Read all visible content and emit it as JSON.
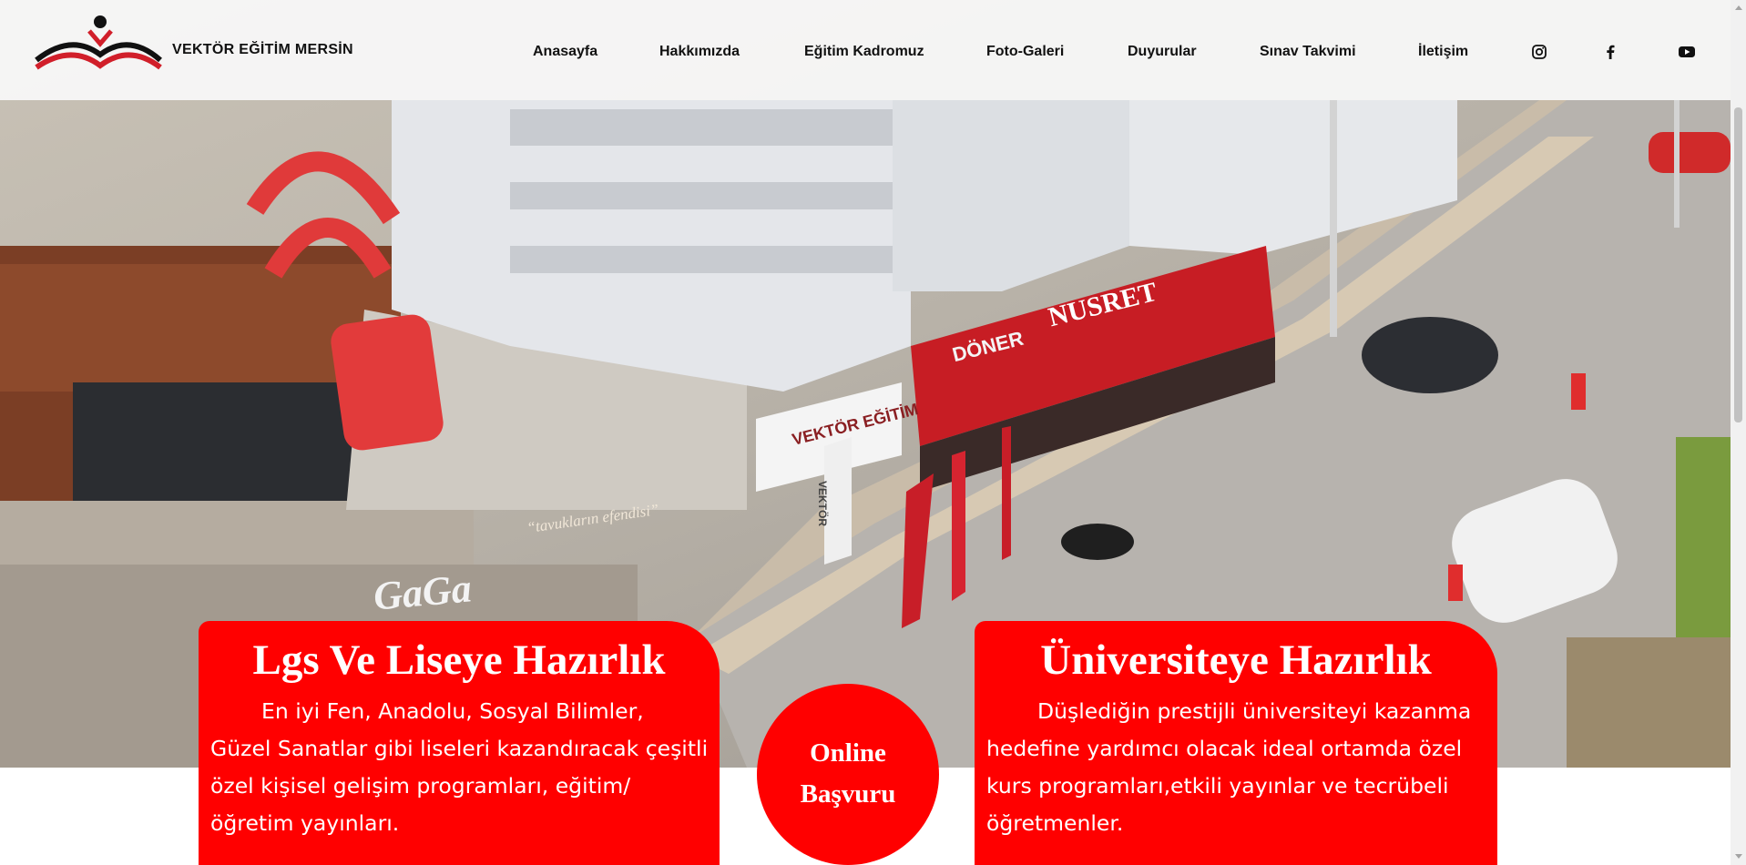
{
  "header": {
    "brand": "VEKTÖR EĞİTİM MERSİN",
    "nav": [
      "Anasayfa",
      "Hakkımızda",
      "Eğitim Kadromuz",
      "Foto-Galeri",
      "Duyurular",
      "Sınav Takvimi",
      "İletişim"
    ],
    "social_icons": [
      "instagram-icon",
      "facebook-icon",
      "youtube-icon"
    ]
  },
  "hero": {
    "image": "aerial street view with Vektör Eğitim building and shops",
    "signs": {
      "left_sign": "GaGa",
      "shop_slogan": "“tavukların efendisi”",
      "doner_sign": "DÖNER",
      "nusret_sign": "NUSRET",
      "school_sign": "VEKTÖR EĞİTİM",
      "pole_sign": "VEKTÖR"
    }
  },
  "cards": {
    "left": {
      "title": "Lgs Ve Liseye Hazırlık",
      "body": "En iyi Fen, Anadolu, Sosyal Bilimler, Güzel Sanatlar gibi liseleri kazandıracak çeşitli özel kişisel gelişim programları, eğitim/öğretim yayınları."
    },
    "right": {
      "title": "Üniversiteye Hazırlık",
      "body": "Düşlediğin prestijli üniversiteyi kazanma hedefine yardımcı olacak ideal ortamda özel kurs programları,etkili yayınlar ve tecrübeli öğretmenler."
    }
  },
  "apply_button": {
    "line1": "Online",
    "line2": "Başvuru"
  },
  "colors": {
    "accent": "#ff0000",
    "header_bg": "#f8f8f8",
    "text": "#111111"
  }
}
